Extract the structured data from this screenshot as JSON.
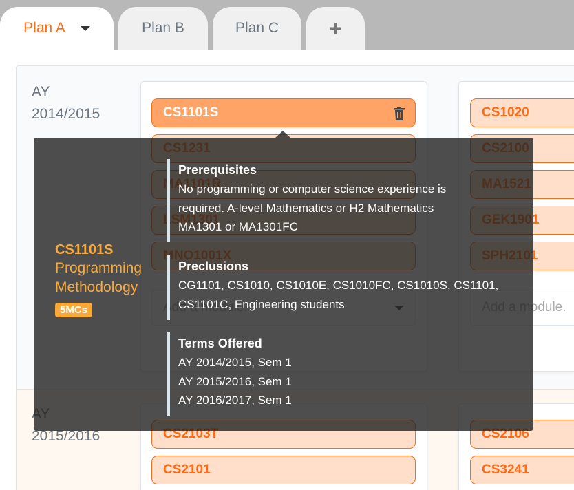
{
  "tabs": [
    {
      "label": "Plan A",
      "active": true
    },
    {
      "label": "Plan B"
    },
    {
      "label": "Plan C"
    },
    {
      "label": "+"
    }
  ],
  "years": [
    {
      "ay": "AY",
      "year": "2014/2015",
      "semesters": [
        {
          "modules": [
            "CS1101S",
            "CS1231",
            "MA1101R",
            "LSM1301",
            "MNO1001X"
          ],
          "add_placeholder": "Add a module."
        },
        {
          "modules": [
            "CS1020",
            "CS2100",
            "MA1521",
            "GEK1901",
            "SPH2101"
          ],
          "add_placeholder": "Add a module."
        }
      ]
    },
    {
      "ay": "AY",
      "year": "2015/2016",
      "semesters": [
        {
          "modules": [
            "CS2103T",
            "CS2101"
          ]
        },
        {
          "modules": [
            "CS2106",
            "CS3241"
          ]
        }
      ]
    }
  ],
  "tooltip": {
    "code": "CS1101S",
    "title_line1": "Programming",
    "title_line2": "Methodology",
    "mcs": "5MCs",
    "prereq_title": "Prerequisites",
    "prereq_lines": [
      "No programming or computer science experience is",
      "required. A-level Mathematics or H2 Mathematics",
      "MA1301 or MA1301FC"
    ],
    "preclusions_title": "Preclusions",
    "preclusions_lines": [
      "CG1101, CS1010, CS1010E, CS1010FC, CS1010S, CS1101,",
      "CS1101C, Engineering students"
    ],
    "terms_title": "Terms Offered",
    "terms": [
      "AY 2014/2015, Sem 1",
      "AY 2015/2016, Sem 1",
      "AY 2016/2017, Sem 1"
    ]
  },
  "colors": {
    "accent": "#ff6a13",
    "module_bg": "#ffdfc9",
    "selected_bg": "#ffa466",
    "mc_badge": "#f9a93a"
  }
}
